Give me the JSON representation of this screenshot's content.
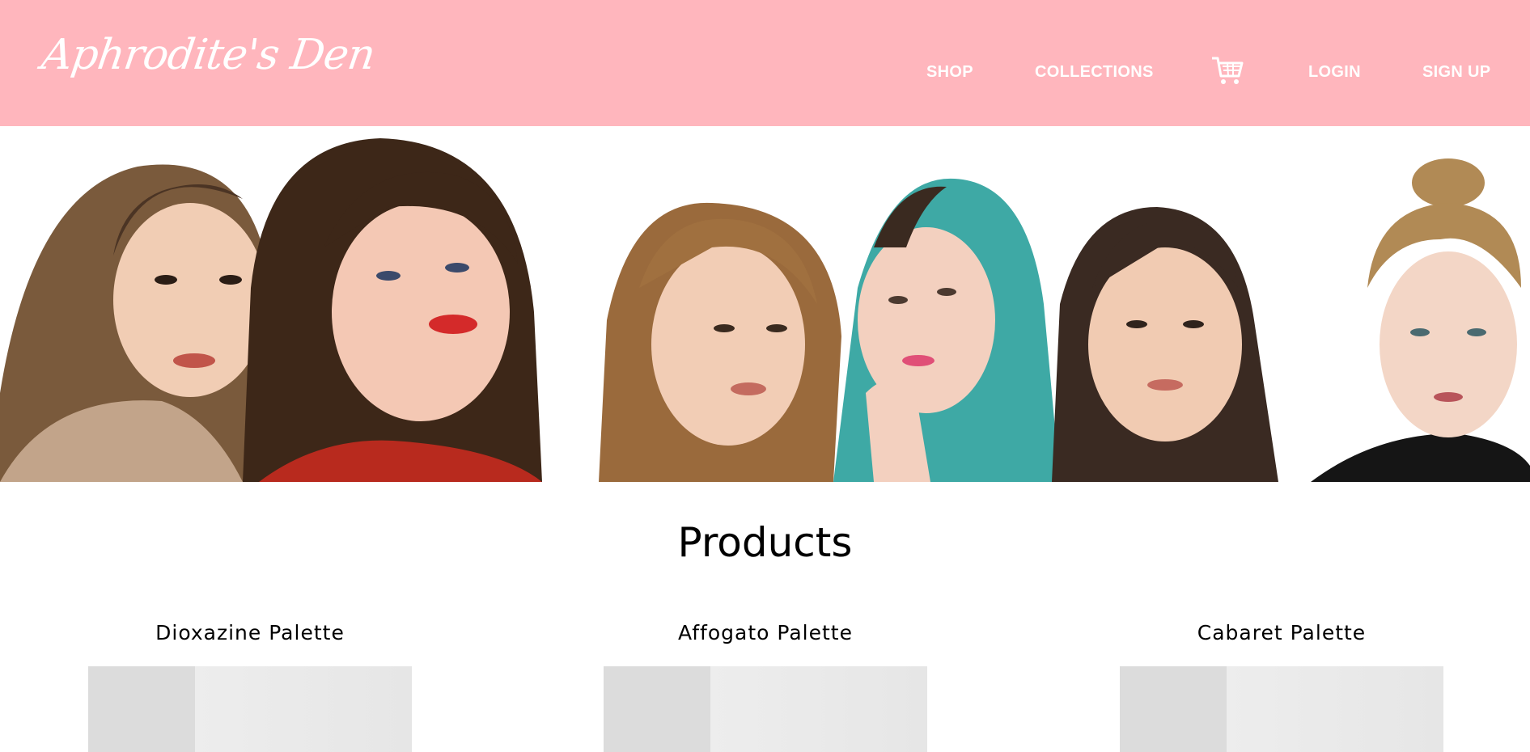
{
  "header": {
    "logo_text": "Aphrodite's Den",
    "nav": {
      "shop": "SHOP",
      "collections": "COLLECTIONS",
      "login": "LOGIN",
      "signup": "SIGN UP"
    },
    "cart_icon": "cart-icon"
  },
  "hero": {
    "image": "group-photo-of-six-models"
  },
  "products": {
    "title": "Products",
    "items": [
      {
        "name": "Dioxazine Palette"
      },
      {
        "name": "Affogato Palette"
      },
      {
        "name": "Cabaret Palette"
      }
    ]
  },
  "colors": {
    "navbar": "#ffb6bd",
    "nav_text": "#ffffff",
    "background": "#ffffff"
  }
}
